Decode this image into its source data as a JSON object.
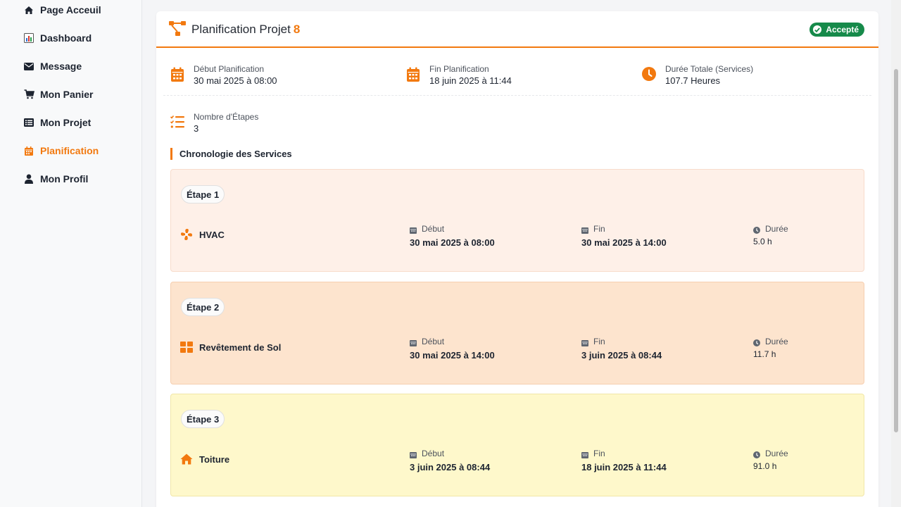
{
  "sidebar": {
    "items": [
      {
        "label": "Page Acceuil",
        "icon": "home-icon"
      },
      {
        "label": "Dashboard",
        "icon": "chart-icon"
      },
      {
        "label": "Message",
        "icon": "envelope-icon"
      },
      {
        "label": "Mon Panier",
        "icon": "cart-icon"
      },
      {
        "label": "Mon Projet",
        "icon": "list-icon"
      },
      {
        "label": "Planification",
        "icon": "calendar-icon",
        "active": true
      },
      {
        "label": "Mon Profil",
        "icon": "user-icon"
      }
    ]
  },
  "header": {
    "title": "Planification Projet",
    "project_number": "8",
    "status": "Accepté"
  },
  "summary": {
    "start": {
      "label": "Début Planification",
      "value": "30 mai 2025 à 08:00"
    },
    "end": {
      "label": "Fin Planification",
      "value": "18 juin 2025 à 11:44"
    },
    "duration": {
      "label": "Durée Totale (Services)",
      "value": "107.7 Heures"
    },
    "steps_count": {
      "label": "Nombre d'Étapes",
      "value": "3"
    }
  },
  "timeline": {
    "title": "Chronologie des Services",
    "start_label": "Début",
    "end_label": "Fin",
    "duration_label": "Durée",
    "steps": [
      {
        "badge": "Étape 1",
        "service": "HVAC",
        "icon": "fan-icon",
        "start": "30 mai 2025 à 08:00",
        "end": "30 mai 2025 à 14:00",
        "duration": "5.0 h"
      },
      {
        "badge": "Étape 2",
        "service": "Revêtement de Sol",
        "icon": "tiles-icon",
        "start": "30 mai 2025 à 14:00",
        "end": "3 juin 2025 à 08:44",
        "duration": "11.7 h"
      },
      {
        "badge": "Étape 3",
        "service": "Toiture",
        "icon": "house-icon",
        "start": "3 juin 2025 à 08:44",
        "end": "18 juin 2025 à 11:44",
        "duration": "91.0 h"
      }
    ]
  },
  "colors": {
    "accent": "#f2790f",
    "success": "#168a4a",
    "step1_bg": "#fef0e8",
    "step2_bg": "#fde4ce",
    "step3_bg": "#fef8cb"
  }
}
